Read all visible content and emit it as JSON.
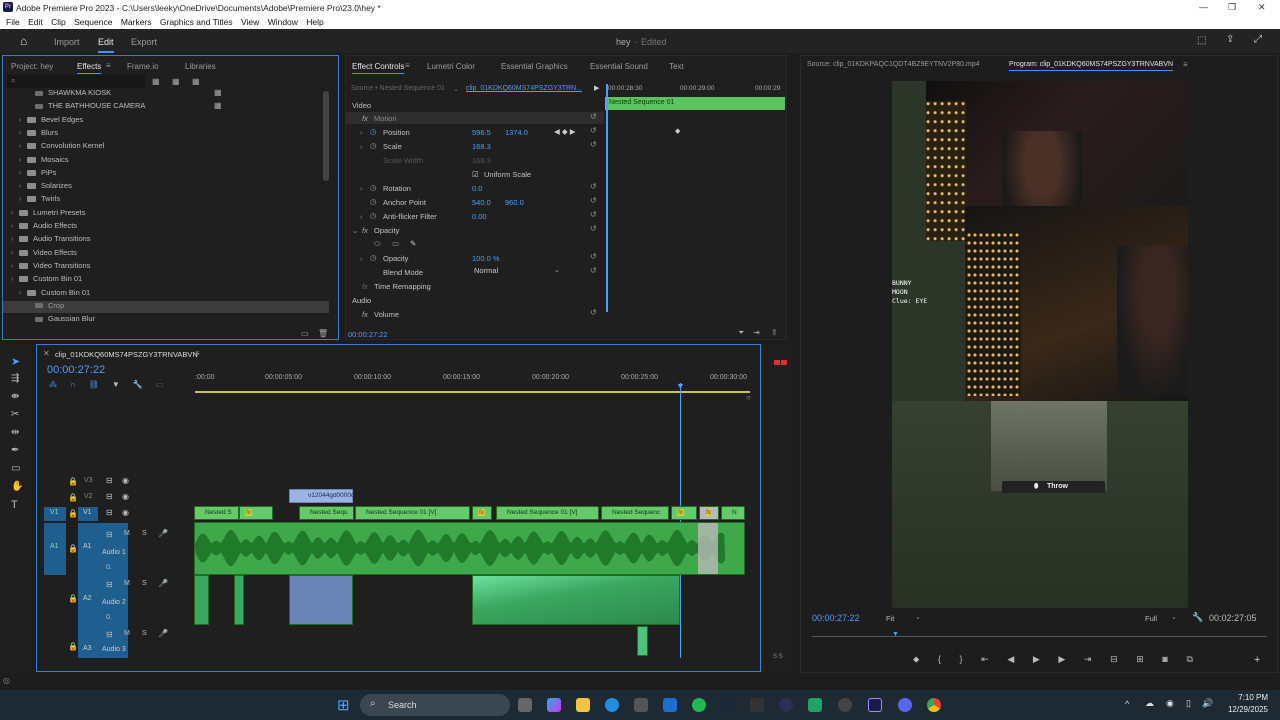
{
  "titlebar": {
    "title": "Adobe Premiere Pro 2023 - C:\\Users\\leeky\\OneDrive\\Documents\\Adobe\\Premiere Pro\\23.0\\hey *",
    "app_icon": "Pr"
  },
  "menu": [
    "File",
    "Edit",
    "Clip",
    "Sequence",
    "Markers",
    "Graphics and Titles",
    "View",
    "Window",
    "Help"
  ],
  "header": {
    "tabs": [
      "Import",
      "Edit",
      "Export"
    ],
    "active": "Edit",
    "project_name": "hey",
    "status": "Edited"
  },
  "project_panel": {
    "tabs": [
      "Project: hey",
      "Effects",
      "Frame.io",
      "Libraries"
    ],
    "active_tab": "Effects",
    "items": [
      {
        "label": "SHAWKMA KIOSK",
        "indent": 2,
        "type": "preset"
      },
      {
        "label": "THE BATHHOUSE CAMERA",
        "indent": 2,
        "type": "preset"
      },
      {
        "label": "Bevel Edges",
        "indent": 1,
        "type": "folder"
      },
      {
        "label": "Blurs",
        "indent": 1,
        "type": "folder"
      },
      {
        "label": "Convolution Kernel",
        "indent": 1,
        "type": "folder"
      },
      {
        "label": "Mosaics",
        "indent": 1,
        "type": "folder"
      },
      {
        "label": "PiPs",
        "indent": 1,
        "type": "folder"
      },
      {
        "label": "Solarizes",
        "indent": 1,
        "type": "folder"
      },
      {
        "label": "Twirls",
        "indent": 1,
        "type": "folder"
      },
      {
        "label": "Lumetri Presets",
        "indent": 0,
        "type": "folder"
      },
      {
        "label": "Audio Effects",
        "indent": 0,
        "type": "folder"
      },
      {
        "label": "Audio Transitions",
        "indent": 0,
        "type": "folder"
      },
      {
        "label": "Video Effects",
        "indent": 0,
        "type": "folder"
      },
      {
        "label": "Video Transitions",
        "indent": 0,
        "type": "folder"
      },
      {
        "label": "Custom Bin 01",
        "indent": 0,
        "type": "folder"
      },
      {
        "label": "Custom Bin 01",
        "indent": 1,
        "type": "folder"
      },
      {
        "label": "Crop",
        "indent": 2,
        "type": "preset",
        "selected": true
      },
      {
        "label": "Gaussian Blur",
        "indent": 2,
        "type": "preset"
      }
    ]
  },
  "effect_controls": {
    "tabs": [
      "Effect Controls",
      "Lumetri Color",
      "Essential Graphics",
      "Essential Sound",
      "Text"
    ],
    "source": "Source • Nested Sequence 01",
    "clip": "clip_01KDKQ60MS74PSZGY3TRN...",
    "mini_tc_1": "00:00:28:30",
    "mini_tc_2": "00:00:29:00",
    "mini_tc_3": "00:00:29",
    "mini_clip": "Nested Sequence 01",
    "video_label": "Video",
    "motion": "Motion",
    "position_label": "Position",
    "position_x": "596.5",
    "position_y": "1374.0",
    "scale_label": "Scale",
    "scale": "168.3",
    "scale_width_label": "Scale Width",
    "scale_width": "168.3",
    "uniform_scale": "Uniform Scale",
    "rotation_label": "Rotation",
    "rotation": "0.0",
    "anchor_label": "Anchor Point",
    "anchor_x": "540.0",
    "anchor_y": "960.0",
    "antiflicker_label": "Anti-flicker Filter",
    "antiflicker": "0.00",
    "opacity_section": "Opacity",
    "opacity_label": "Opacity",
    "opacity": "100.0 %",
    "blend_label": "Blend Mode",
    "blend": "Normal",
    "time_remap": "Time Remapping",
    "audio_label": "Audio",
    "volume": "Volume",
    "timecode": "00:00:27:22"
  },
  "program_monitor": {
    "source_tab": "Source: clip_01KDKPAQC1QDT4BZ9EYTNV2P80.mp4",
    "program_tab": "Program: clip_01KDKQ60MS74PSZGY3TRNVABVN",
    "overlay_lines": [
      "BUNNY ",
      "MOON ",
      "Clue: EYE "
    ],
    "throw_label": "Throw",
    "timecode": "00:00:27:22",
    "fit": "Fit",
    "quality": "Full",
    "duration": "00:02:27:05"
  },
  "timeline": {
    "sequence": "clip_01KDKQ60MS74PSZGY3TRNVABVN",
    "timecode": "00:00:27:22",
    "ruler": [
      ":00:00",
      "00:00:05:00",
      "00:00:10:00",
      "00:00:15:00",
      "00:00:20:00",
      "00:00:25:00",
      "00:00:30:00"
    ],
    "tracks": {
      "v3": "V3",
      "v2": "V2",
      "v1": "V1",
      "v1_src": "V1",
      "a1": "A1",
      "a1_src": "A1",
      "a1_name": "Audio 1",
      "a2": "A2",
      "a2_name": "Audio 2",
      "a3": "A3",
      "a3_name": "Audio 3",
      "vol_a1": "0.",
      "vol_a2": "0."
    },
    "v2_clip": "v12044gd0000c",
    "v1_clips": [
      "Nested S",
      "Nested Sequ",
      "Nested Sequence 01 [V]",
      "Nested Sequence 01 [V]",
      "Nested Sequenc",
      "N"
    ],
    "fx_label": "fx",
    "m_label": "M",
    "s_label": "S",
    "ss_label": "S S"
  },
  "taskbar": {
    "search": "Search",
    "time": "7:10 PM",
    "date": "12/29/2025"
  }
}
